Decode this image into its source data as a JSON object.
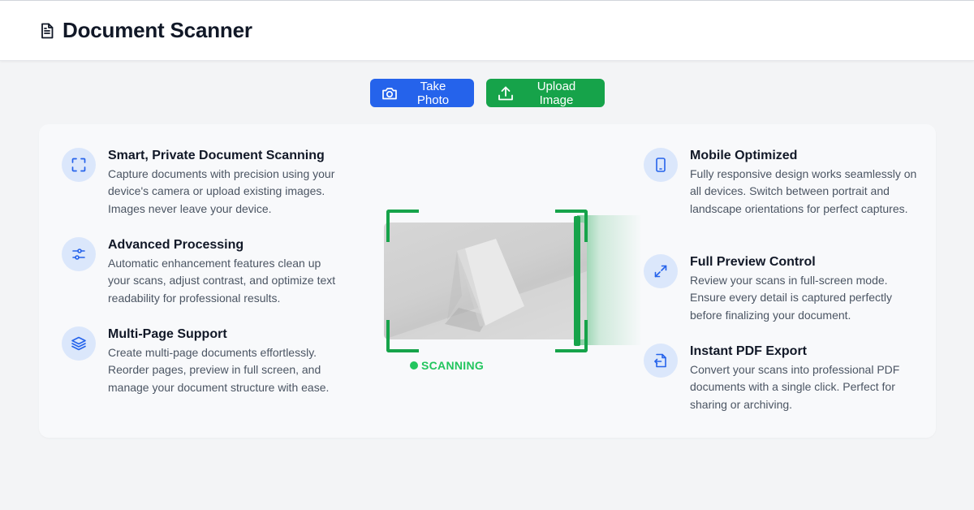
{
  "header": {
    "title": "Document Scanner",
    "icon": "document-icon"
  },
  "actions": {
    "take_photo": {
      "label": "Take Photo",
      "icon": "camera-icon",
      "color": "#2563eb"
    },
    "upload_image": {
      "label": "Upload Image",
      "icon": "upload-icon",
      "color": "#16a34a"
    }
  },
  "features_left": [
    {
      "title": "Smart, Private Document Scanning",
      "description": "Capture documents with precision using your device's camera or upload existing images. Images never leave your device.",
      "icon": "scan-frame-icon"
    },
    {
      "title": "Advanced Processing",
      "description": "Automatic enhancement features clean up your scans, adjust contrast, and optimize text readability for professional results.",
      "icon": "sliders-icon"
    },
    {
      "title": "Multi-Page Support",
      "description": "Create multi-page documents effortlessly. Reorder pages, preview in full screen, and manage your document structure with ease.",
      "icon": "layers-icon"
    }
  ],
  "features_right": [
    {
      "title": "Mobile Optimized",
      "description": "Fully responsive design works seamlessly on all devices. Switch between portrait and landscape orientations for perfect captures.",
      "icon": "smartphone-icon"
    },
    {
      "title": "Full Preview Control",
      "description": "Review your scans in full-screen mode. Ensure every detail is captured perfectly before finalizing your document.",
      "icon": "expand-icon"
    },
    {
      "title": "Instant PDF Export",
      "description": "Convert your scans into professional PDF documents with a single click. Perfect for sharing or archiving.",
      "icon": "file-export-icon"
    }
  ],
  "scanner": {
    "status": "SCANNING",
    "accent": "#16a34a"
  }
}
